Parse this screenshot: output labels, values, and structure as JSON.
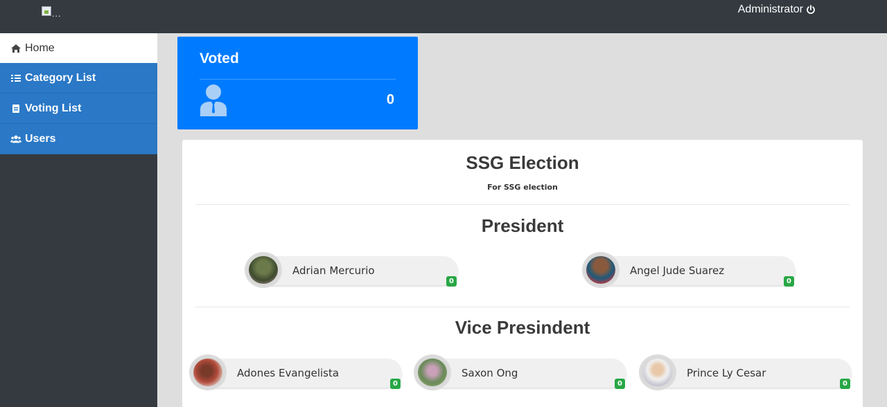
{
  "header": {
    "logo_alt": "...",
    "user_label": "Administrator",
    "power_icon": "power-icon"
  },
  "sidebar": {
    "items": [
      {
        "label": "Home",
        "icon": "home-icon",
        "active": true
      },
      {
        "label": "Category List",
        "icon": "list-icon",
        "active": false
      },
      {
        "label": "Voting List",
        "icon": "file-icon",
        "active": false
      },
      {
        "label": "Users",
        "icon": "users-icon",
        "active": false
      }
    ]
  },
  "voted_card": {
    "title": "Voted",
    "count": "0",
    "icon": "user-tie-icon",
    "color": "#007bff"
  },
  "election": {
    "title": "SSG Election",
    "subtitle": "For SSG election",
    "categories": [
      {
        "title": "President",
        "candidates": [
          {
            "name": "Adrian Mercurio",
            "votes": "0"
          },
          {
            "name": "Angel Jude Suarez",
            "votes": "0"
          }
        ]
      },
      {
        "title": "Vice Presindent",
        "candidates": [
          {
            "name": "Adones Evangelista",
            "votes": "0"
          },
          {
            "name": "Saxon Ong",
            "votes": "0"
          },
          {
            "name": "Prince Ly Cesar",
            "votes": "0"
          }
        ]
      }
    ]
  },
  "colors": {
    "topbar": "#343a40",
    "sidebar_item": "#2a78c6",
    "badge": "#28a745"
  }
}
